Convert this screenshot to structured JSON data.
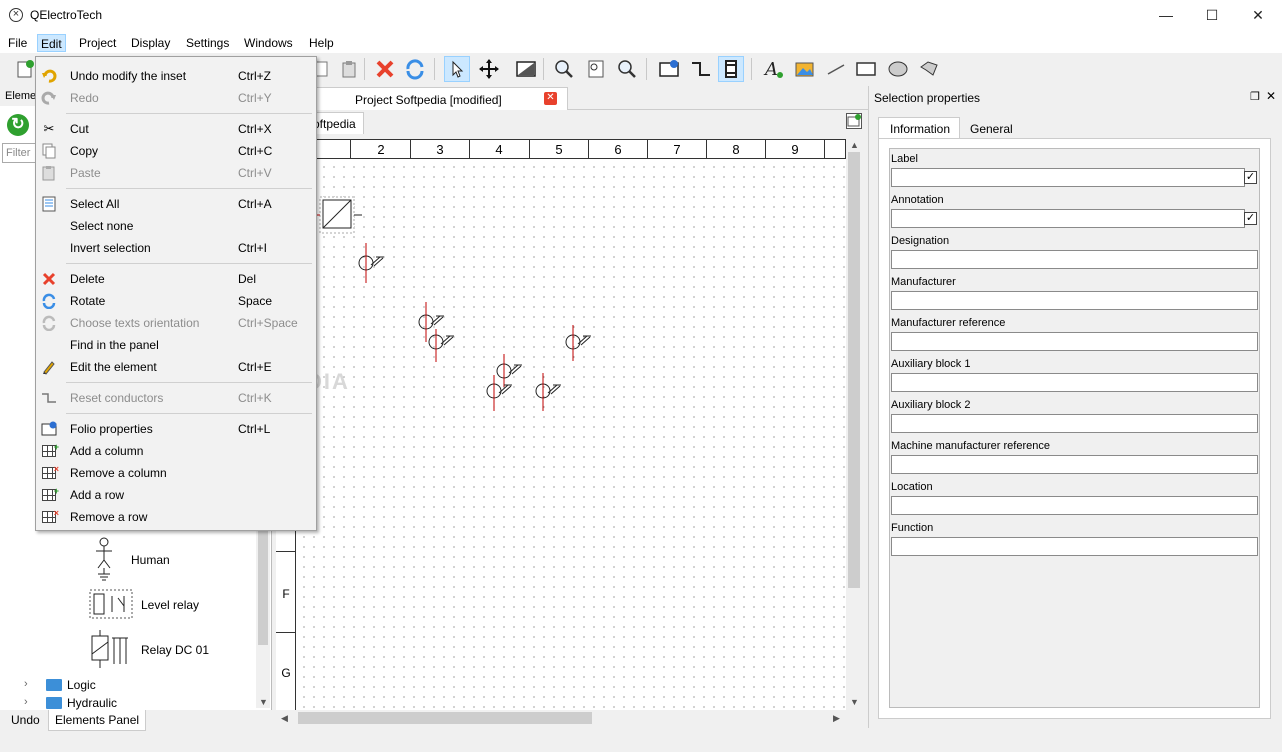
{
  "window": {
    "title": "QElectroTech",
    "minimize": "—",
    "maximize": "☐",
    "close": "✕"
  },
  "menubar": [
    "File",
    "Edit",
    "Project",
    "Display",
    "Settings",
    "Windows",
    "Help"
  ],
  "left_dock": {
    "title": "Eleme",
    "filter_placeholder": "Filter"
  },
  "elements": [
    {
      "label": "Human"
    },
    {
      "label": "Level relay"
    },
    {
      "label": "Relay DC 01"
    }
  ],
  "tree": [
    {
      "label": "Logic"
    },
    {
      "label": "Hydraulic"
    }
  ],
  "bottom_tabs": {
    "undo": "Undo",
    "elements": "Elements Panel"
  },
  "document": {
    "tab_label": "Project Softpedia [modified]",
    "close_glyph": "✕",
    "folio_tab": "oftpedia"
  },
  "columns": [
    "1",
    "2",
    "3",
    "4",
    "5",
    "6",
    "7",
    "8",
    "9"
  ],
  "rows": [
    "F",
    "G"
  ],
  "watermark": "SOFTPEDIA",
  "selection_panel": {
    "title": "Selection properties",
    "tab_information": "Information",
    "tab_general": "General",
    "fields": [
      {
        "label": "Label",
        "checkbox": true
      },
      {
        "label": "Annotation",
        "checkbox": true
      },
      {
        "label": "Designation"
      },
      {
        "label": "Manufacturer"
      },
      {
        "label": "Manufacturer reference"
      },
      {
        "label": "Auxiliary block 1"
      },
      {
        "label": "Auxiliary block 2"
      },
      {
        "label": "Machine manufacturer reference"
      },
      {
        "label": "Location"
      },
      {
        "label": "Function"
      }
    ]
  },
  "edit_menu": [
    {
      "label": "Undo modify the inset",
      "shortcut": "Ctrl+Z",
      "icon": "undo-icon",
      "disabled": false
    },
    {
      "label": "Redo",
      "shortcut": "Ctrl+Y",
      "icon": "redo-icon",
      "disabled": true
    },
    {
      "label": "Cut",
      "shortcut": "Ctrl+X",
      "icon": "scissors-icon",
      "disabled": false
    },
    {
      "label": "Copy",
      "shortcut": "Ctrl+C",
      "icon": "copy-icon",
      "disabled": false
    },
    {
      "label": "Paste",
      "shortcut": "Ctrl+V",
      "icon": "paste-icon",
      "disabled": true
    },
    {
      "label": "Select All",
      "shortcut": "Ctrl+A",
      "icon": "select-all-icon",
      "disabled": false
    },
    {
      "label": "Select none",
      "shortcut": "",
      "icon": "",
      "disabled": false
    },
    {
      "label": "Invert selection",
      "shortcut": "Ctrl+I",
      "icon": "",
      "disabled": false
    },
    {
      "label": "Delete",
      "shortcut": "Del",
      "icon": "delete-icon",
      "disabled": false
    },
    {
      "label": "Rotate",
      "shortcut": "Space",
      "icon": "rotate-icon",
      "disabled": false
    },
    {
      "label": "Choose texts orientation",
      "shortcut": "Ctrl+Space",
      "icon": "text-orientation-icon",
      "disabled": true
    },
    {
      "label": "Find in the panel",
      "shortcut": "",
      "icon": "",
      "disabled": false
    },
    {
      "label": "Edit the element",
      "shortcut": "Ctrl+E",
      "icon": "pencil-icon",
      "disabled": false
    },
    {
      "label": "Reset conductors",
      "shortcut": "Ctrl+K",
      "icon": "conductor-icon",
      "disabled": true
    },
    {
      "label": "Folio properties",
      "shortcut": "Ctrl+L",
      "icon": "folio-properties-icon",
      "disabled": false
    },
    {
      "label": "Add a column",
      "shortcut": "",
      "icon": "add-column-icon",
      "disabled": false
    },
    {
      "label": "Remove a column",
      "shortcut": "",
      "icon": "remove-column-icon",
      "disabled": false
    },
    {
      "label": "Add a row",
      "shortcut": "",
      "icon": "add-row-icon",
      "disabled": false
    },
    {
      "label": "Remove a row",
      "shortcut": "",
      "icon": "remove-row-icon",
      "disabled": false
    }
  ],
  "colors": {
    "accent": "#cce8ff",
    "delete": "#e8412c",
    "rotate": "#3a8ee6",
    "folder": "#3c8fd8",
    "wire": "#c00000"
  }
}
